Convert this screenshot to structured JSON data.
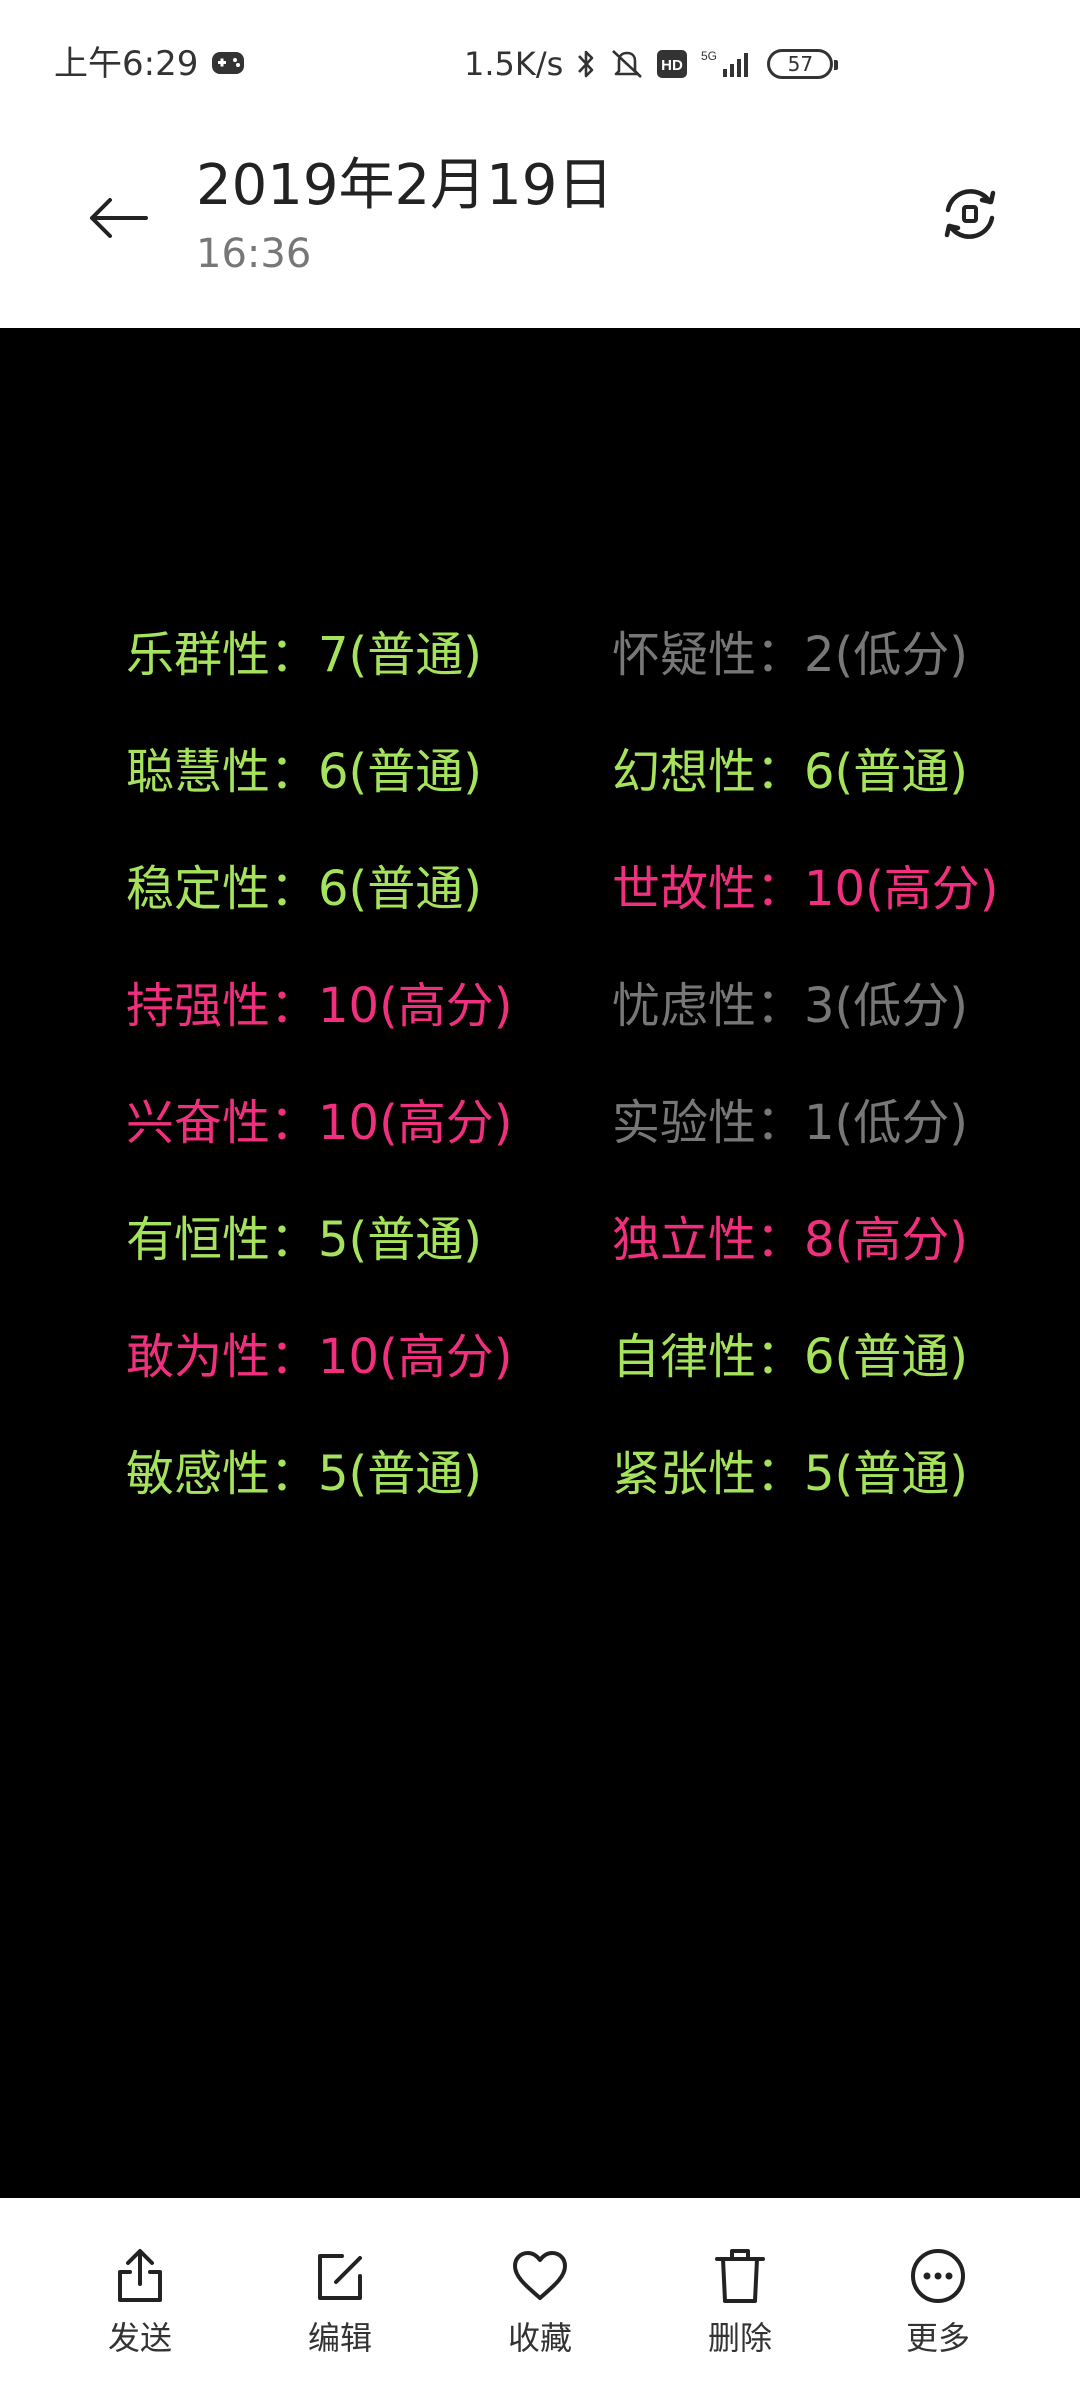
{
  "status_bar": {
    "time": "上午6:29",
    "net_speed": "1.5K/s",
    "hd_badge": "HD",
    "network": "5G",
    "battery": "57",
    "icons": [
      "gamepad-icon",
      "bluetooth-icon",
      "mute-icon",
      "hd-icon",
      "signal-icon",
      "battery-icon"
    ]
  },
  "header": {
    "title": "2019年2月19日",
    "subtitle": "16:36",
    "back_icon": "arrow-left-icon",
    "rotate_icon": "rotate-icon"
  },
  "traits": {
    "rows": [
      {
        "left": {
          "text": "乐群性：7(普通)",
          "level": "normal"
        },
        "right": {
          "text": "怀疑性：2(低分)",
          "level": "low"
        }
      },
      {
        "left": {
          "text": "聪慧性：6(普通)",
          "level": "normal"
        },
        "right": {
          "text": "幻想性：6(普通)",
          "level": "normal"
        }
      },
      {
        "left": {
          "text": "稳定性：6(普通)",
          "level": "normal"
        },
        "right": {
          "text": "世故性：10(高分)",
          "level": "high"
        }
      },
      {
        "left": {
          "text": "持强性：10(高分)",
          "level": "high"
        },
        "right": {
          "text": "忧虑性：3(低分)",
          "level": "low"
        }
      },
      {
        "left": {
          "text": "兴奋性：10(高分)",
          "level": "high"
        },
        "right": {
          "text": "实验性：1(低分)",
          "level": "low"
        }
      },
      {
        "left": {
          "text": "有恒性：5(普通)",
          "level": "normal"
        },
        "right": {
          "text": "独立性：8(高分)",
          "level": "high"
        }
      },
      {
        "left": {
          "text": "敢为性：10(高分)",
          "level": "high"
        },
        "right": {
          "text": "自律性：6(普通)",
          "level": "normal"
        }
      },
      {
        "left": {
          "text": "敏感性：5(普通)",
          "level": "normal"
        },
        "right": {
          "text": "紧张性：5(普通)",
          "level": "normal"
        }
      }
    ],
    "colors": {
      "normal": "#a6e35c",
      "high": "#f0307e",
      "low": "#777777"
    }
  },
  "toolbar": {
    "items": [
      {
        "label": "发送",
        "icon": "share-icon"
      },
      {
        "label": "编辑",
        "icon": "edit-icon"
      },
      {
        "label": "收藏",
        "icon": "heart-icon"
      },
      {
        "label": "删除",
        "icon": "trash-icon"
      },
      {
        "label": "更多",
        "icon": "more-icon"
      }
    ]
  }
}
